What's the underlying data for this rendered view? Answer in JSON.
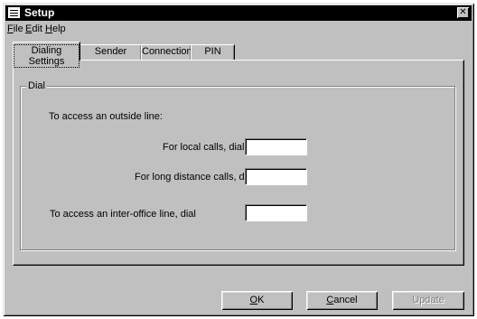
{
  "window": {
    "title": "Setup",
    "close_glyph": "✕"
  },
  "menu": [
    {
      "label": "File",
      "accel": "F",
      "rest": "ile"
    },
    {
      "label": "Edit",
      "accel": "E",
      "rest": "dit"
    },
    {
      "label": "Help",
      "accel": "H",
      "rest": "elp"
    }
  ],
  "tabs": [
    {
      "label": "Dialing Settings",
      "active": true
    },
    {
      "label": "Sender Details"
    },
    {
      "label": "Connection"
    },
    {
      "label": "PIN Code"
    }
  ],
  "dial_group": {
    "title": "Dial",
    "outside_line_label": "To access an outside line:",
    "local_label": "For local calls, dial",
    "local_value": "",
    "long_distance_label": "For long distance calls, dial",
    "long_distance_value": "",
    "inter_office_label": "To access an inter-office line, dial",
    "inter_office_value": ""
  },
  "buttons": {
    "ok": {
      "accel": "O",
      "rest": "K"
    },
    "cancel": {
      "accel": "C",
      "rest": "ancel"
    },
    "update": {
      "label": "Update",
      "enabled": false
    }
  }
}
